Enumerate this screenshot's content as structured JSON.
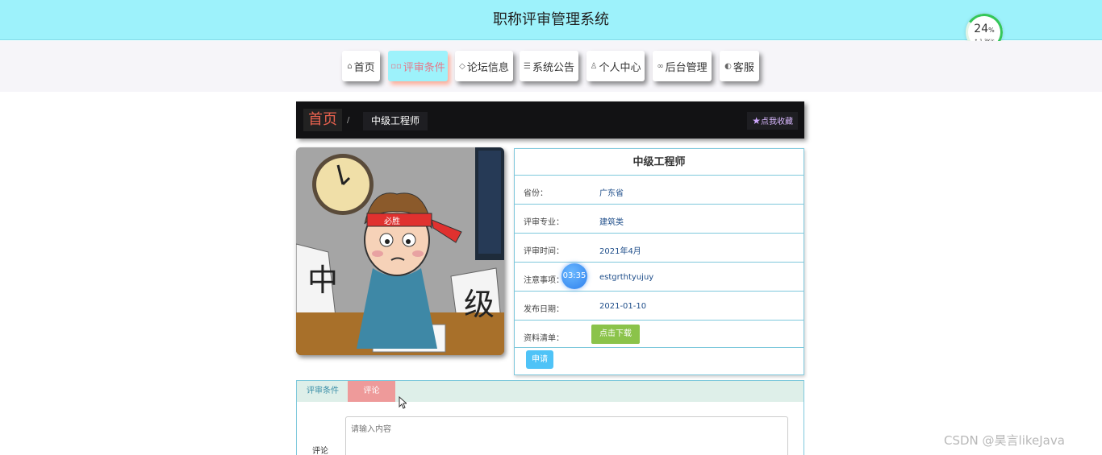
{
  "header": {
    "title": "职称评审管理系统"
  },
  "speed_widget": {
    "percent": "24",
    "percent_sign": "%",
    "rate": "↑ 1.3K/s"
  },
  "nav": {
    "items": [
      {
        "label": "首页",
        "icon": "home-icon",
        "glyph": "⌂"
      },
      {
        "label": "评审条件",
        "icon": "grid-icon",
        "glyph": "▫▫"
      },
      {
        "label": "论坛信息",
        "icon": "tag-icon",
        "glyph": "◇"
      },
      {
        "label": "系统公告",
        "icon": "notice-icon",
        "glyph": "☰"
      },
      {
        "label": "个人中心",
        "icon": "user-icon",
        "glyph": "♙"
      },
      {
        "label": "后台管理",
        "icon": "link-icon",
        "glyph": "∞"
      },
      {
        "label": "客服",
        "icon": "support-icon",
        "glyph": "◐"
      }
    ],
    "active_index": 1
  },
  "breadcrumb": {
    "home": "首页",
    "separator": "/",
    "current": "中级工程师",
    "favorite_label": "点我收藏"
  },
  "hero_image": {
    "alt": "中级工程师",
    "words": [
      "中",
      "级",
      "必胜"
    ]
  },
  "info": {
    "title": "中级工程师",
    "rows": [
      {
        "label": "省份：",
        "value": "广东省"
      },
      {
        "label": "评审专业：",
        "value": "建筑类"
      },
      {
        "label": "评审时间：",
        "value": "2021年4月"
      },
      {
        "label": "注意事项：",
        "value": "estgrthtyujuy"
      },
      {
        "label": "发布日期：",
        "value": "2021-01-10"
      },
      {
        "label": "资料清单：",
        "value": ""
      }
    ],
    "download_label": "点击下载",
    "apply_label": "申请"
  },
  "timer_badge": "03:35",
  "tabs": {
    "items": [
      "评审条件",
      "评论"
    ],
    "active_index": 1
  },
  "comment": {
    "label": "评论",
    "placeholder": "请输入内容"
  },
  "watermark": "CSDN @昊言likeJava",
  "colors": {
    "header_bg": "#9df2fb",
    "active_nav_text": "#e4788a",
    "download_btn": "#8bc34a",
    "apply_btn": "#4fc3f7",
    "tab_active": "#ee9a9a"
  }
}
